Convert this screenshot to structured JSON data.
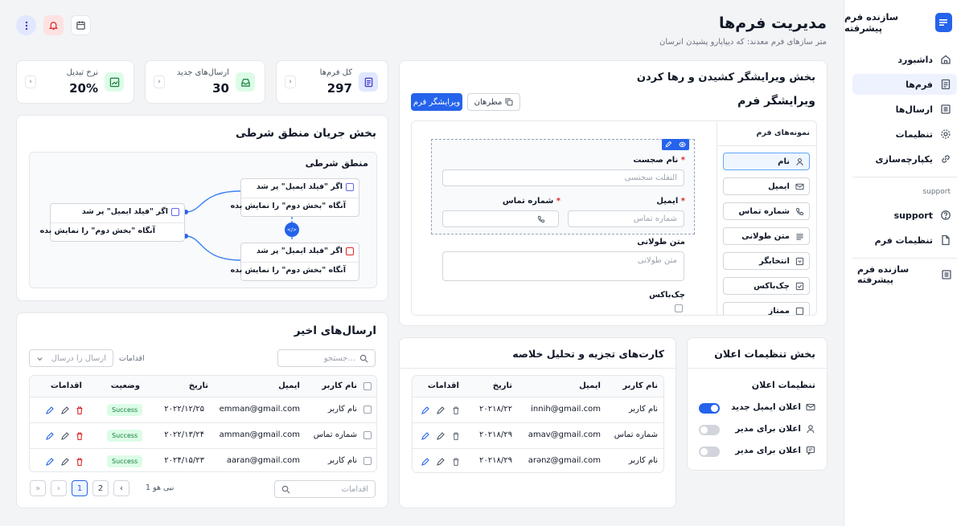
{
  "colors": {
    "accent": "#2563eb",
    "success_bg": "#dcfce7",
    "success_fg": "#15803d",
    "danger": "#dc2626"
  },
  "header": {
    "title": "مدیریت فرم‌ها",
    "subtitle": "متر سازهای فرم معدند: که دیپاپارو پشیدن انرسان",
    "actions": [
      "calendar-icon",
      "bell-icon",
      "more-vertical-icon"
    ]
  },
  "sidebar": {
    "brand": "سازنده فرم پیشرفته",
    "items": [
      {
        "label": "داشبورد",
        "icon": "home-icon"
      },
      {
        "label": "فرم‌ها",
        "icon": "document-icon"
      },
      {
        "label": "ارسال‌ها",
        "icon": "list-icon"
      },
      {
        "label": "تنظیمات",
        "icon": "gear-icon"
      },
      {
        "label": "یکپارچه‌سازی",
        "icon": "link-icon"
      }
    ],
    "section": "support",
    "support_items": [
      {
        "label": "support",
        "icon": "help-icon"
      },
      {
        "label": "تنظیمات فرم",
        "icon": "file-icon"
      }
    ],
    "footer": "سازنده فرم پیشرفته"
  },
  "stats": [
    {
      "label": "کل فرم‌ها",
      "value": "297"
    },
    {
      "label": "ارسال‌های جدید",
      "value": "30"
    },
    {
      "label": "نرخ تبدیل",
      "value": "20%"
    }
  ],
  "builder": {
    "section_title": "بخش ویرایشگر کشیدن و رها کردن",
    "title": "ویرایشگر فرم",
    "btn_preview": "مطرهان",
    "btn_editor": "ویرایشگر فرم",
    "palette_title": "نمونه‌های فرم",
    "palette": [
      {
        "label": "نام",
        "icon": "user-icon"
      },
      {
        "label": "ایمیل",
        "icon": "mail-icon"
      },
      {
        "label": "شماره تماس",
        "icon": "phone-icon"
      },
      {
        "label": "متن طولانی",
        "icon": "text-lines-icon"
      },
      {
        "label": "انتخابگر",
        "icon": "select-icon"
      },
      {
        "label": "چک‌باکس",
        "icon": "checkbox-icon"
      },
      {
        "label": "ممتاز",
        "icon": "star-icon"
      }
    ],
    "fields": {
      "name_label": "نام صجست",
      "name_placeholder": "النفلت سجتسی",
      "email_label": "ایمیل",
      "email_placeholder": "شماره تماس",
      "phone_label": "شماره تماس",
      "textarea_label": "متن طولانی",
      "textarea_placeholder": "متن طولانی",
      "checkbox_label": "چک‌باکس"
    }
  },
  "logic": {
    "section_title": "بخش جریان منطق شرطی",
    "subtitle": "منطق شرطی",
    "rules": [
      {
        "cond": "اگر \"فیلد ایمیل\" پر شد",
        "action": "آنگاه \"بخش دوم\" را نمایش بده"
      },
      {
        "cond": "اگر \"فیلد ایمیل\" پر شد",
        "action": "آنگاه \"بخش دوم\" را نمایش بده"
      },
      {
        "cond": "اگر \"فیلد ایمیل\" پر شد",
        "action": "آنگاه \"بخش دوم\" را نمایش بده"
      }
    ],
    "connector": "</>"
  },
  "recent": {
    "title": "ارسال‌های اخیر",
    "search_placeholder": "...جستجو",
    "actions_label": "اقدامات",
    "filter_placeholder": "ارسال را درسال",
    "columns": [
      "نام کاربر",
      "ایمیل",
      "تاریخ",
      "وضعیت",
      "اقدامات"
    ],
    "rows": [
      {
        "name": "نام کاربر",
        "email": "emman@gmail.com",
        "date": "۲۰۲۲/۱۲/۲۵",
        "status": "Success"
      },
      {
        "name": "شماره تماس",
        "email": "amman@gmail.com",
        "date": "۲۰۲۲/۱۳/۲۴",
        "status": "Success"
      },
      {
        "name": "نام کاربر",
        "email": "aaran@gmail.com",
        "date": "۲۰۲۴/۱۵/۲۳",
        "status": "Success"
      }
    ],
    "pagination": {
      "info": "1 نیی هو",
      "pages": [
        "1",
        "2"
      ],
      "current": "1",
      "search_placeholder": "اقدامات"
    }
  },
  "analytics": {
    "title": "کارت‌های تجزیه و تحلیل خلاصه",
    "columns": [
      "نام کاربر",
      "ایمیل",
      "تاریخ",
      "اقدامات"
    ],
    "rows": [
      {
        "name": "نام کاربر",
        "email": "innih@gmail.com",
        "date": "۲۰۲۱۸/۲۲"
      },
      {
        "name": "شماره تماس",
        "email": "amav@gmail.com",
        "date": "۲۰۲۱۸/۲۹"
      },
      {
        "name": "نام کاربر",
        "email": "arənz@gmail.com",
        "date": "۲۰۲۱۸/۲۹"
      }
    ]
  },
  "notifications": {
    "section_title": "بخش تنظیمات اعلان",
    "subtitle": "تنظیمات اعلان",
    "items": [
      {
        "label": "اعلان ایمیل جدید",
        "icon": "mail-icon",
        "on": true
      },
      {
        "label": "اعلان برای مدیر",
        "icon": "user-icon",
        "on": false
      },
      {
        "label": "اعلان برای مدیر",
        "icon": "message-icon",
        "on": false
      }
    ]
  }
}
